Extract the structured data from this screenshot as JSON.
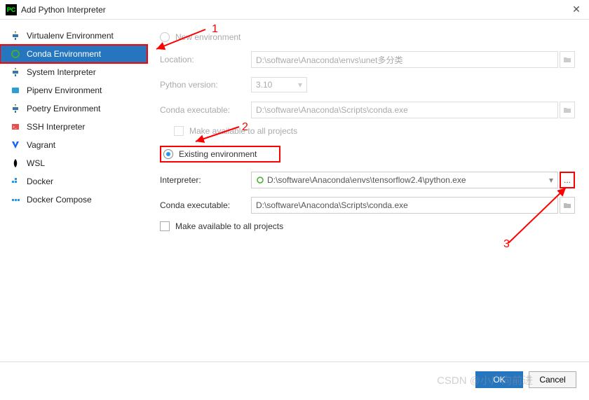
{
  "window": {
    "title": "Add Python Interpreter"
  },
  "sidebar": {
    "items": [
      {
        "label": "Virtualenv Environment",
        "icon": "python-icon"
      },
      {
        "label": "Conda Environment",
        "icon": "conda-icon",
        "selected": true
      },
      {
        "label": "System Interpreter",
        "icon": "python-icon"
      },
      {
        "label": "Pipenv Environment",
        "icon": "pipenv-icon"
      },
      {
        "label": "Poetry Environment",
        "icon": "poetry-icon"
      },
      {
        "label": "SSH Interpreter",
        "icon": "ssh-icon"
      },
      {
        "label": "Vagrant",
        "icon": "vagrant-icon"
      },
      {
        "label": "WSL",
        "icon": "wsl-icon"
      },
      {
        "label": "Docker",
        "icon": "docker-icon"
      },
      {
        "label": "Docker Compose",
        "icon": "docker-compose-icon"
      }
    ]
  },
  "form": {
    "new_env_radio": "New environment",
    "location_label": "Location:",
    "location_value": "D:\\software\\Anaconda\\envs\\unet多分类",
    "python_version_label": "Python version:",
    "python_version_value": "3.10",
    "conda_exec_label": "Conda executable:",
    "conda_exec_value_top": "D:\\software\\Anaconda\\Scripts\\conda.exe",
    "make_available_top": "Make available to all projects",
    "existing_env_radio": "Existing environment",
    "interpreter_label": "Interpreter:",
    "interpreter_value": "D:\\software\\Anaconda\\envs\\tensorflow2.4\\python.exe",
    "conda_exec_value_bottom": "D:\\software\\Anaconda\\Scripts\\conda.exe",
    "make_available_bottom": "Make available to all projects",
    "browse_label": "..."
  },
  "buttons": {
    "ok": "OK",
    "cancel": "Cancel"
  },
  "annotations": {
    "one": "1",
    "two": "2",
    "three": "3"
  },
  "watermark": "CSDN @小广向前进",
  "colors": {
    "selection": "#2675BF",
    "annotation": "#ff0000"
  }
}
